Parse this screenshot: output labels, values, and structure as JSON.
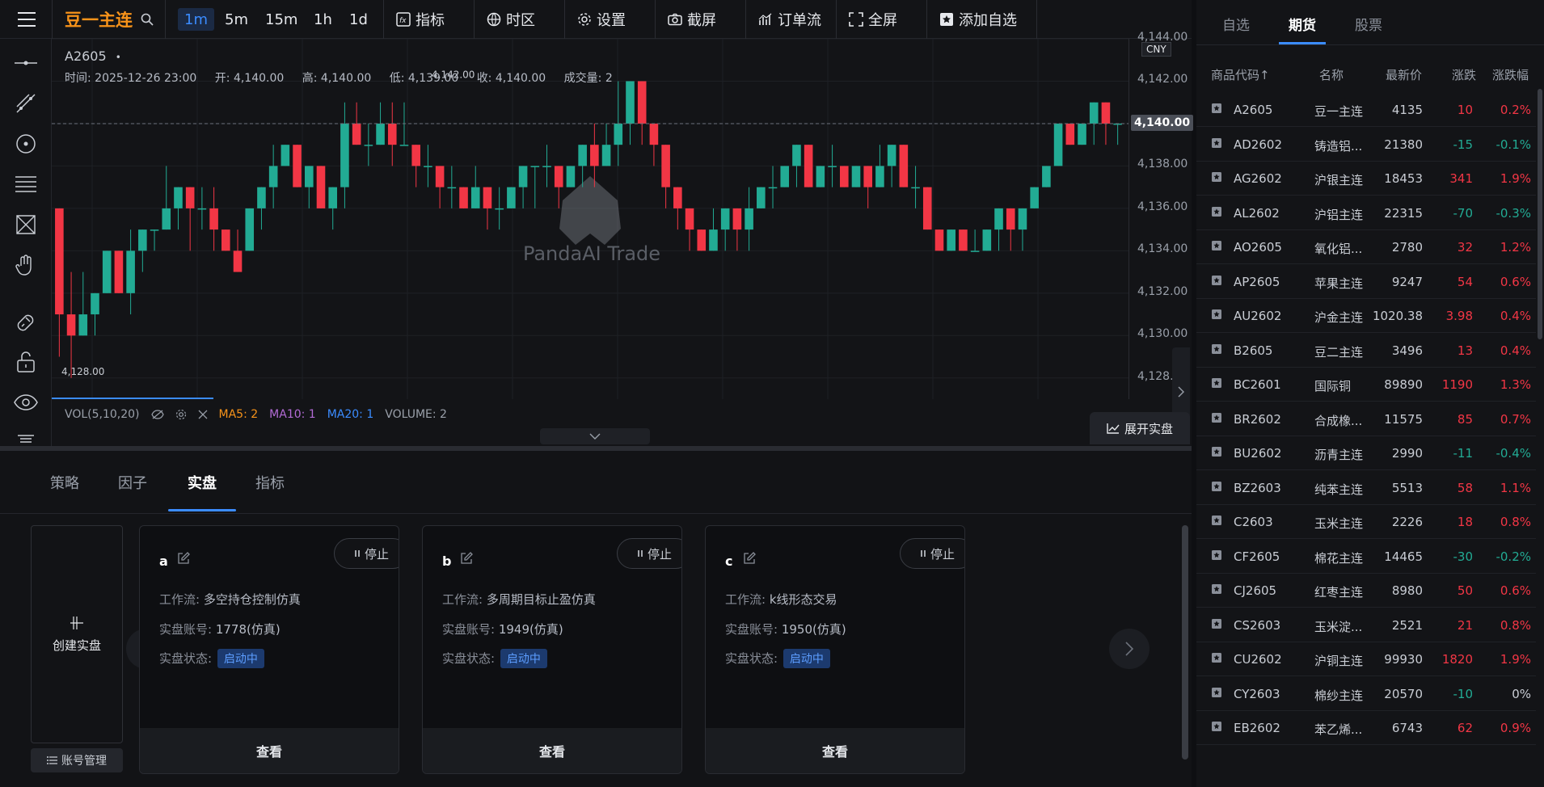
{
  "topbar": {
    "symbol": "豆一主连",
    "intervals": [
      "1m",
      "5m",
      "15m",
      "1h",
      "1d"
    ],
    "active_interval": "1m",
    "indicator_label": "指标",
    "timezone_label": "时区",
    "settings_label": "设置",
    "screenshot_label": "截屏",
    "orderflow_label": "订单流",
    "fullscreen_label": "全屏",
    "add_watch_label": "添加自选"
  },
  "chart": {
    "symbol_label": "A2605",
    "dot": "•",
    "time_label": "时间: 2025-12-26 23:00",
    "open_label": "开: 4,140.00",
    "high_label": "高: 4,140.00",
    "low_label": "低: 4,139.00",
    "close_label": "收: 4,140.00",
    "vol_label": "成交量: 2",
    "currency": "CNY",
    "last_price": "4,140.00",
    "high_mark": "4,142.00",
    "low_mark": "4,128.00",
    "watermark": "PandaAI Trade",
    "price_ticks": [
      "4,144.00",
      "4,142.00",
      "4,140.00",
      "4,138.00",
      "4,136.00",
      "4,134.00",
      "4,132.00",
      "4,130.00",
      "4,128.00"
    ],
    "vol_study": "VOL(5,10,20)",
    "ma5": "MA5: 2",
    "ma10": "MA10: 1",
    "ma20": "MA20: 1",
    "volume": "VOLUME: 2",
    "expand_label": "展开实盘"
  },
  "chart_data": {
    "type": "candlestick",
    "symbol": "A2605",
    "y_range": [
      4127,
      4144
    ],
    "candles": [
      [
        4136,
        4131,
        4136,
        4129
      ],
      [
        4131,
        4130,
        4133,
        4128
      ],
      [
        4130,
        4131,
        4133,
        4130
      ],
      [
        4131,
        4132,
        4132,
        4130
      ],
      [
        4132,
        4134,
        4134,
        4132
      ],
      [
        4134,
        4132,
        4134,
        4132
      ],
      [
        4132,
        4134,
        4135,
        4131
      ],
      [
        4134,
        4135,
        4135,
        4133
      ],
      [
        4135,
        4135,
        4135,
        4134
      ],
      [
        4135,
        4136,
        4138,
        4135
      ],
      [
        4136,
        4137,
        4137,
        4135
      ],
      [
        4137,
        4136,
        4137,
        4134
      ],
      [
        4136,
        4136,
        4137,
        4135
      ],
      [
        4136,
        4135,
        4137,
        4134
      ],
      [
        4135,
        4134,
        4135,
        4134
      ],
      [
        4134,
        4133,
        4135,
        4133
      ],
      [
        4134,
        4136,
        4136,
        4134
      ],
      [
        4136,
        4137,
        4137,
        4135
      ],
      [
        4137,
        4138,
        4139,
        4136
      ],
      [
        4138,
        4139,
        4139,
        4138
      ],
      [
        4139,
        4137,
        4139,
        4137
      ],
      [
        4137,
        4138,
        4138,
        4136
      ],
      [
        4138,
        4136,
        4138,
        4136
      ],
      [
        4136,
        4137,
        4137,
        4135
      ],
      [
        4137,
        4140,
        4141,
        4136
      ],
      [
        4140,
        4139,
        4141,
        4139
      ],
      [
        4139,
        4139,
        4140,
        4138
      ],
      [
        4139,
        4140,
        4141,
        4139
      ],
      [
        4140,
        4139,
        4141,
        4138
      ],
      [
        4139,
        4139,
        4141,
        4139
      ],
      [
        4139,
        4138,
        4139,
        4137
      ],
      [
        4138,
        4138,
        4139,
        4137
      ],
      [
        4138,
        4137,
        4138,
        4136
      ],
      [
        4137,
        4137,
        4138,
        4136
      ],
      [
        4137,
        4136,
        4137,
        4136
      ],
      [
        4136,
        4137,
        4138,
        4136
      ],
      [
        4137,
        4136,
        4137,
        4135
      ],
      [
        4136,
        4136,
        4137,
        4135
      ],
      [
        4136,
        4137,
        4137,
        4136
      ],
      [
        4137,
        4138,
        4138,
        4136
      ],
      [
        4138,
        4138,
        4138,
        4136
      ],
      [
        4138,
        4138,
        4139,
        4137
      ],
      [
        4138,
        4137,
        4138,
        4136
      ],
      [
        4137,
        4138,
        4138,
        4137
      ],
      [
        4138,
        4139,
        4139,
        4137
      ],
      [
        4139,
        4138,
        4140,
        4137
      ],
      [
        4138,
        4139,
        4140,
        4138
      ],
      [
        4139,
        4140,
        4142,
        4138
      ],
      [
        4140,
        4142,
        4142,
        4139
      ],
      [
        4142,
        4140,
        4142,
        4139
      ],
      [
        4140,
        4139,
        4140,
        4138
      ],
      [
        4139,
        4137,
        4139,
        4136
      ],
      [
        4137,
        4136,
        4137,
        4135
      ],
      [
        4136,
        4135,
        4136,
        4134
      ],
      [
        4135,
        4134,
        4135,
        4134
      ],
      [
        4134,
        4135,
        4136,
        4134
      ],
      [
        4135,
        4136,
        4136,
        4134
      ],
      [
        4136,
        4135,
        4136,
        4134
      ],
      [
        4135,
        4136,
        4137,
        4134
      ],
      [
        4136,
        4137,
        4137,
        4136
      ],
      [
        4137,
        4137,
        4138,
        4136
      ],
      [
        4137,
        4138,
        4138,
        4137
      ],
      [
        4138,
        4139,
        4139,
        4137
      ],
      [
        4139,
        4137,
        4139,
        4137
      ],
      [
        4137,
        4138,
        4138,
        4137
      ],
      [
        4138,
        4138,
        4139,
        4137
      ],
      [
        4138,
        4137,
        4138,
        4137
      ],
      [
        4137,
        4138,
        4138,
        4137
      ],
      [
        4138,
        4137,
        4138,
        4136
      ],
      [
        4137,
        4138,
        4139,
        4137
      ],
      [
        4138,
        4139,
        4139,
        4137
      ],
      [
        4139,
        4137,
        4139,
        4137
      ],
      [
        4137,
        4137,
        4138,
        4136
      ],
      [
        4137,
        4135,
        4137,
        4135
      ],
      [
        4135,
        4134,
        4135,
        4134
      ],
      [
        4134,
        4135,
        4135,
        4134
      ],
      [
        4135,
        4134,
        4135,
        4134
      ],
      [
        4134,
        4134,
        4135,
        4134
      ],
      [
        4134,
        4135,
        4135,
        4134
      ],
      [
        4135,
        4136,
        4136,
        4134
      ],
      [
        4136,
        4135,
        4136,
        4134
      ],
      [
        4135,
        4136,
        4136,
        4134
      ],
      [
        4136,
        4137,
        4137,
        4136
      ],
      [
        4137,
        4138,
        4138,
        4137
      ],
      [
        4138,
        4140,
        4140,
        4138
      ],
      [
        4140,
        4139,
        4140,
        4139
      ],
      [
        4139,
        4140,
        4140,
        4139
      ],
      [
        4140,
        4141,
        4141,
        4139
      ],
      [
        4141,
        4140,
        4141,
        4139
      ],
      [
        4140,
        4140,
        4140,
        4139
      ]
    ]
  },
  "bottom": {
    "tabs": [
      "策略",
      "因子",
      "实盘",
      "指标"
    ],
    "active_tab": "实盘",
    "create_label": "创建实盘",
    "account_label": "账号管理",
    "cards": [
      {
        "name": "a",
        "stop": "停止",
        "workflow_key": "工作流:",
        "workflow": "多空持仓控制仿真",
        "account_key": "实盘账号:",
        "account": "1778(仿真)",
        "status_key": "实盘状态:",
        "status": "启动中",
        "view": "查看"
      },
      {
        "name": "b",
        "stop": "停止",
        "workflow_key": "工作流:",
        "workflow": "多周期目标止盈仿真",
        "account_key": "实盘账号:",
        "account": "1949(仿真)",
        "status_key": "实盘状态:",
        "status": "启动中",
        "view": "查看"
      },
      {
        "name": "c",
        "stop": "停止",
        "workflow_key": "工作流:",
        "workflow": "k线形态交易",
        "account_key": "实盘账号:",
        "account": "1950(仿真)",
        "status_key": "实盘状态:",
        "status": "启动中",
        "view": "查看"
      }
    ]
  },
  "watchlist": {
    "tabs": [
      "自选",
      "期货",
      "股票"
    ],
    "active_tab": "期货",
    "headers": [
      "商品代码↑",
      "名称",
      "最新价",
      "涨跌",
      "涨跌幅"
    ],
    "up_color": "#f23645",
    "down_color": "#22ab94",
    "rows": [
      {
        "code": "A2605",
        "name": "豆一主连",
        "last": "4135",
        "chg": "10",
        "pct": "0.2%",
        "dir": "up"
      },
      {
        "code": "AD2602",
        "name": "铸造铝...",
        "last": "21380",
        "chg": "-15",
        "pct": "-0.1%",
        "dir": "dn"
      },
      {
        "code": "AG2602",
        "name": "沪银主连",
        "last": "18453",
        "chg": "341",
        "pct": "1.9%",
        "dir": "up"
      },
      {
        "code": "AL2602",
        "name": "沪铝主连",
        "last": "22315",
        "chg": "-70",
        "pct": "-0.3%",
        "dir": "dn"
      },
      {
        "code": "AO2605",
        "name": "氧化铝...",
        "last": "2780",
        "chg": "32",
        "pct": "1.2%",
        "dir": "up"
      },
      {
        "code": "AP2605",
        "name": "苹果主连",
        "last": "9247",
        "chg": "54",
        "pct": "0.6%",
        "dir": "up"
      },
      {
        "code": "AU2602",
        "name": "沪金主连",
        "last": "1020.38",
        "chg": "3.98",
        "pct": "0.4%",
        "dir": "up"
      },
      {
        "code": "B2605",
        "name": "豆二主连",
        "last": "3496",
        "chg": "13",
        "pct": "0.4%",
        "dir": "up"
      },
      {
        "code": "BC2601",
        "name": "国际铜",
        "last": "89890",
        "chg": "1190",
        "pct": "1.3%",
        "dir": "up"
      },
      {
        "code": "BR2602",
        "name": "合成橡...",
        "last": "11575",
        "chg": "85",
        "pct": "0.7%",
        "dir": "up"
      },
      {
        "code": "BU2602",
        "name": "沥青主连",
        "last": "2990",
        "chg": "-11",
        "pct": "-0.4%",
        "dir": "dn"
      },
      {
        "code": "BZ2603",
        "name": "纯苯主连",
        "last": "5513",
        "chg": "58",
        "pct": "1.1%",
        "dir": "up"
      },
      {
        "code": "C2603",
        "name": "玉米主连",
        "last": "2226",
        "chg": "18",
        "pct": "0.8%",
        "dir": "up"
      },
      {
        "code": "CF2605",
        "name": "棉花主连",
        "last": "14465",
        "chg": "-30",
        "pct": "-0.2%",
        "dir": "dn"
      },
      {
        "code": "CJ2605",
        "name": "红枣主连",
        "last": "8980",
        "chg": "50",
        "pct": "0.6%",
        "dir": "up"
      },
      {
        "code": "CS2603",
        "name": "玉米淀...",
        "last": "2521",
        "chg": "21",
        "pct": "0.8%",
        "dir": "up"
      },
      {
        "code": "CU2602",
        "name": "沪铜主连",
        "last": "99930",
        "chg": "1820",
        "pct": "1.9%",
        "dir": "up"
      },
      {
        "code": "CY2603",
        "name": "棉纱主连",
        "last": "20570",
        "chg": "-10",
        "pct": "0%",
        "dir": "dn"
      },
      {
        "code": "EB2602",
        "name": "苯乙烯...",
        "last": "6743",
        "chg": "62",
        "pct": "0.9%",
        "dir": "up"
      }
    ]
  }
}
